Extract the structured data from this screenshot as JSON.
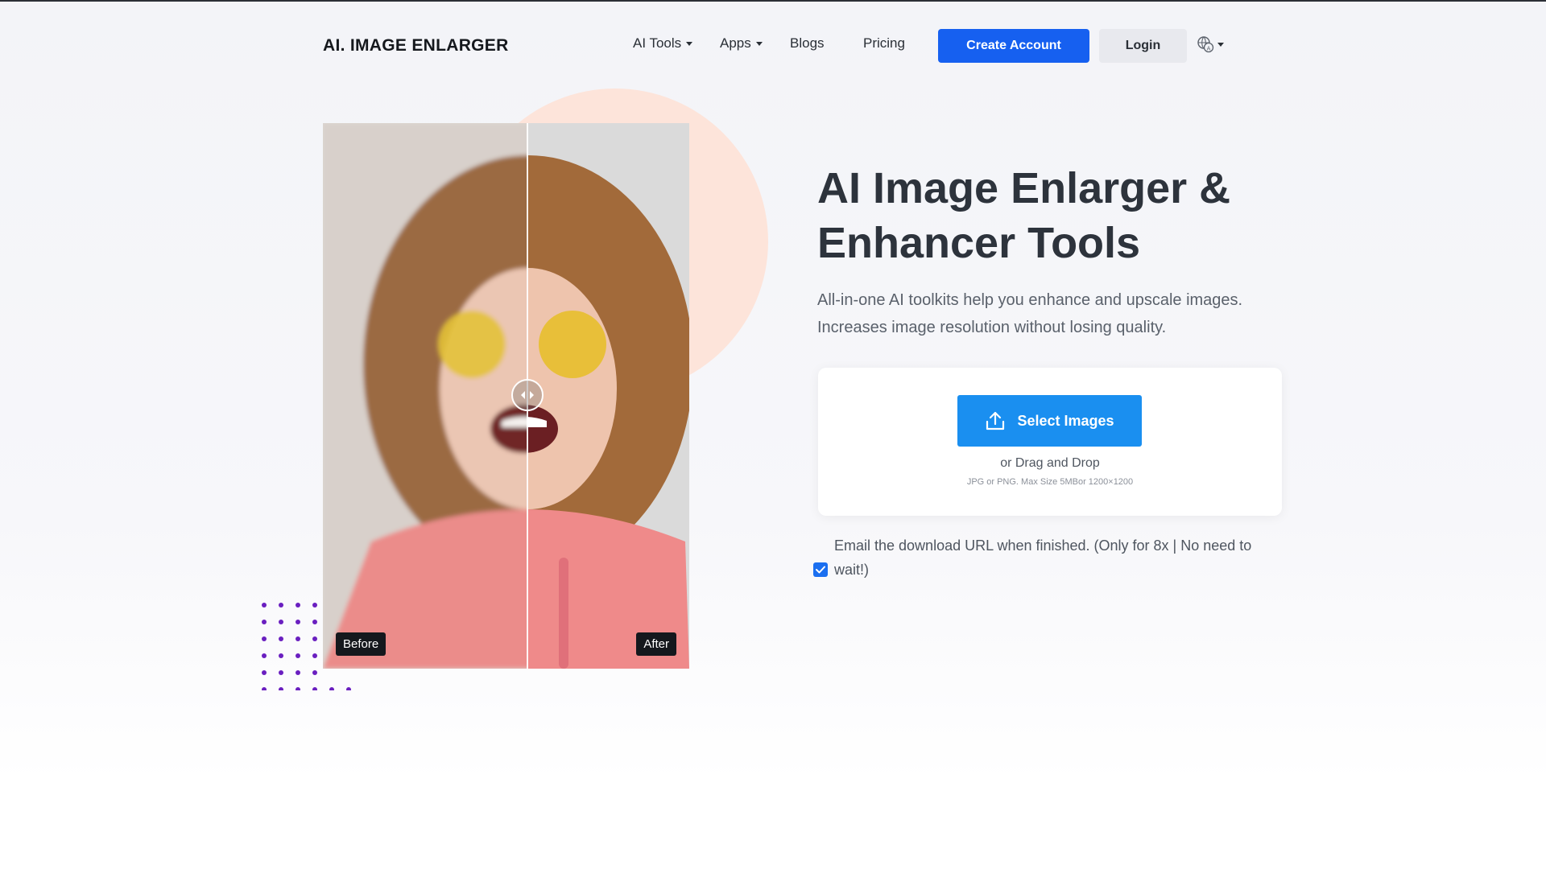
{
  "header": {
    "logo": "AI. IMAGE ENLARGER",
    "nav": [
      {
        "label": "AI Tools",
        "has_caret": true
      },
      {
        "label": "Apps",
        "has_caret": true
      },
      {
        "label": "Blogs",
        "has_caret": false
      },
      {
        "label": "Pricing",
        "has_caret": false
      }
    ],
    "create_account": "Create Account",
    "login": "Login",
    "language_icon": "globe-translate-icon"
  },
  "comparison": {
    "before_label": "Before",
    "after_label": "After",
    "handle_icon": "left-right-arrows-icon"
  },
  "hero": {
    "title_line1": "AI Image Enlarger &",
    "title_line2": "Enhancer Tools",
    "subtitle_line1": "All-in-one AI toolkits help you enhance and upscale images.",
    "subtitle_line2": "Increases image resolution without losing quality."
  },
  "upload": {
    "select_label": "Select Images",
    "upload_icon": "upload-icon",
    "drag_text": "or Drag and Drop",
    "hint": "JPG or PNG. Max Size 5MBor 1200×1200"
  },
  "email_option": {
    "checked": true,
    "text": "Email the download URL when finished. (Only for 8x | No need to wait!)"
  },
  "colors": {
    "primary": "#1660f0",
    "select_button": "#1a8ff0",
    "peach": "#fde4da",
    "dots": "#6a1fc0"
  }
}
